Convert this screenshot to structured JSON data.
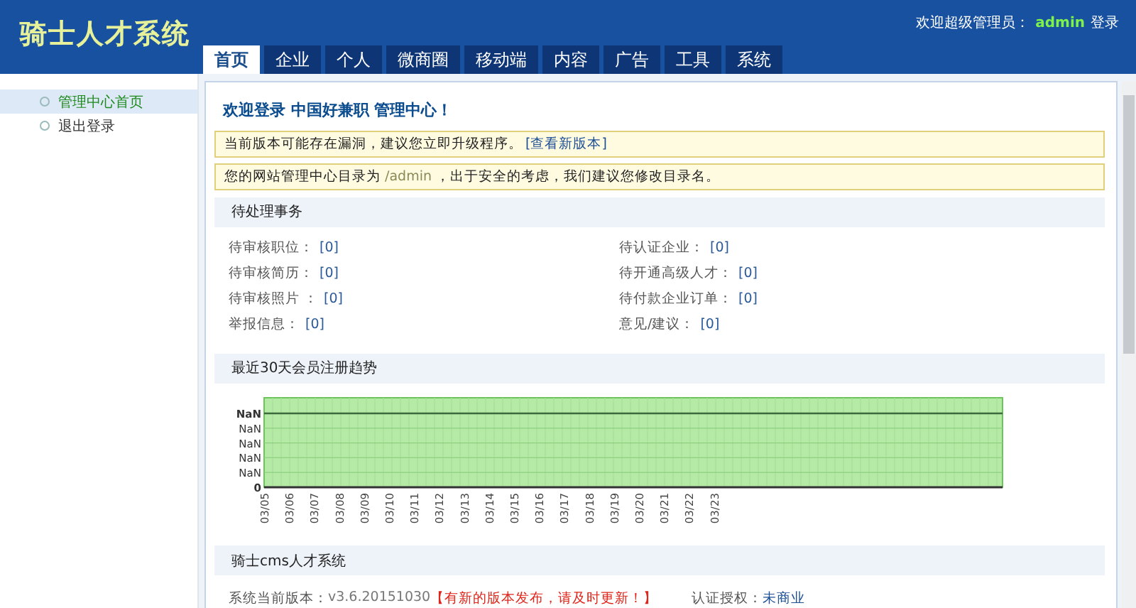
{
  "header": {
    "logo": "骑士人才系统",
    "welcome": "欢迎超级管理员：",
    "user": "admin",
    "login_link": "登录"
  },
  "tabs": [
    {
      "label": "首页",
      "selected": true
    },
    {
      "label": "企业",
      "selected": false
    },
    {
      "label": "个人",
      "selected": false
    },
    {
      "label": "微商圈",
      "selected": false
    },
    {
      "label": "移动端",
      "selected": false
    },
    {
      "label": "内容",
      "selected": false
    },
    {
      "label": "广告",
      "selected": false
    },
    {
      "label": "工具",
      "selected": false
    },
    {
      "label": "系统",
      "selected": false
    }
  ],
  "sidebar": {
    "items": [
      {
        "label": "管理中心首页",
        "selected": true
      },
      {
        "label": "退出登录",
        "selected": false
      }
    ]
  },
  "main": {
    "title": "欢迎登录 中国好兼职 管理中心！",
    "notices": [
      {
        "text": "当前版本可能存在漏洞，建议您立即升级程序。",
        "link": "[查看新版本]"
      },
      {
        "text": "您的网站管理中心目录为 ",
        "path": "/admin",
        "suffix": " ，出于安全的考虑，我们建议您修改目录名。"
      }
    ],
    "pending": {
      "title": "待处理事务",
      "items": [
        {
          "label": "待审核职位：",
          "count": "[0]"
        },
        {
          "label": "待认证企业：",
          "count": "[0]"
        },
        {
          "label": "待审核简历：",
          "count": "[0]"
        },
        {
          "label": "待开通高级人才：",
          "count": "[0]"
        },
        {
          "label": "待审核照片 ：",
          "count": "[0]"
        },
        {
          "label": "待付款企业订单：",
          "count": "[0]"
        },
        {
          "label": "举报信息：",
          "count": "[0]"
        },
        {
          "label": "意见/建议：",
          "count": "[0]"
        }
      ]
    },
    "trend": {
      "title": "最近30天会员注册趋势",
      "y_labels": [
        "NaN",
        "NaN",
        "NaN",
        "NaN",
        "NaN",
        "0"
      ],
      "x_labels": [
        "03/05",
        "03/06",
        "03/07",
        "03/08",
        "03/09",
        "03/10",
        "03/11",
        "03/12",
        "03/13",
        "03/14",
        "03/15",
        "03/16",
        "03/17",
        "03/18",
        "03/19",
        "03/20",
        "03/21",
        "03/22",
        "03/23"
      ]
    },
    "system": {
      "title": "骑士cms人才系统",
      "version_label": "系统当前版本：",
      "version": "v3.6.20151030",
      "update_alert": "【有新的版本发布，请及时更新！】",
      "license_label": "认证授权：",
      "license": "未商业"
    }
  }
}
